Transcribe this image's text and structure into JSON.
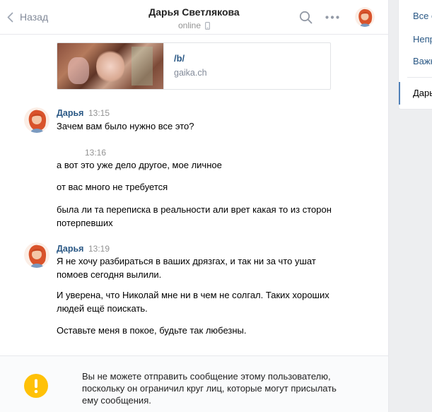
{
  "header": {
    "back_label": "Назад",
    "contact_name": "Дарья Светлякова",
    "status": "online"
  },
  "attachment": {
    "title": "/b/",
    "domain": "gaika.ch"
  },
  "messages": [
    {
      "author": "Дарья",
      "time": "13:15",
      "lines": [
        "Зачем вам было нужно все это?"
      ]
    },
    {
      "author": "",
      "time": "13:16",
      "lines": [
        "а вот это уже дело другое, мое личное",
        "от вас много не требуется",
        "была ли та переписка в реальности али врет какая то из сторон потерпевших"
      ]
    },
    {
      "author": "Дарья",
      "time": "13:19",
      "lines": [
        "Я не хочу разбираться в ваших дрязгах, и так ни за что ушат помоев сегодня вылили.",
        "И уверена, что Николай мне ни в чем не солгал. Таких хороших людей ещё поискать.",
        "Оставьте меня в покое, будьте так любезны."
      ]
    }
  ],
  "footer": {
    "notice": "Вы не можете отправить сообщение этому пользователю, поскольку он ограничил круг лиц, которые могут присылать ему сообщения."
  },
  "sidebar": {
    "items": [
      "Все с",
      "Непр",
      "Важн"
    ],
    "active_item": "Дарь"
  },
  "colors": {
    "link": "#2a5885",
    "muted": "#939393",
    "warning": "#ffc107",
    "accent": "#5181b8"
  }
}
